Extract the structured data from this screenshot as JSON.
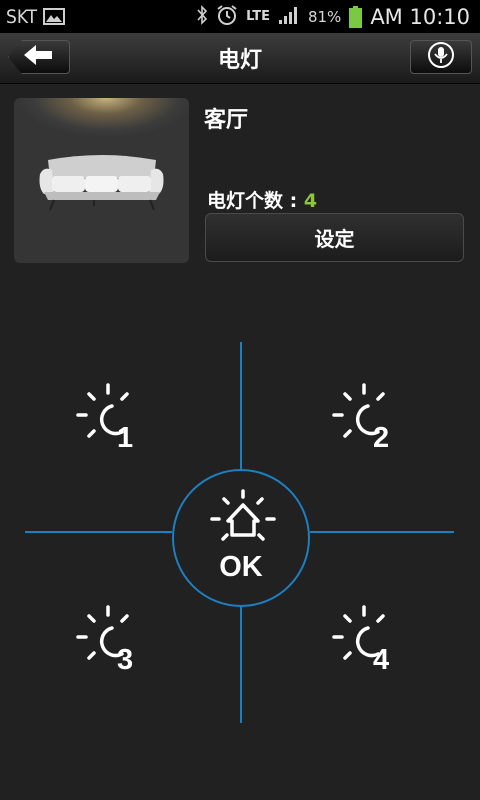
{
  "status_bar": {
    "carrier": "SKT",
    "network": "LTE",
    "battery": "81%",
    "time": "AM 10:10"
  },
  "header": {
    "title": "电灯"
  },
  "room": {
    "name": "客厅",
    "count_label": "电灯个数 : ",
    "count_value": "4",
    "set_button": "设定"
  },
  "controls": {
    "ok_label": "OK",
    "lamps": [
      {
        "label": "1"
      },
      {
        "label": "2"
      },
      {
        "label": "3"
      },
      {
        "label": "4"
      }
    ]
  },
  "colors": {
    "accent_line": "#1e7fc0",
    "count_value": "#8cc63f",
    "battery": "#7ac943"
  }
}
